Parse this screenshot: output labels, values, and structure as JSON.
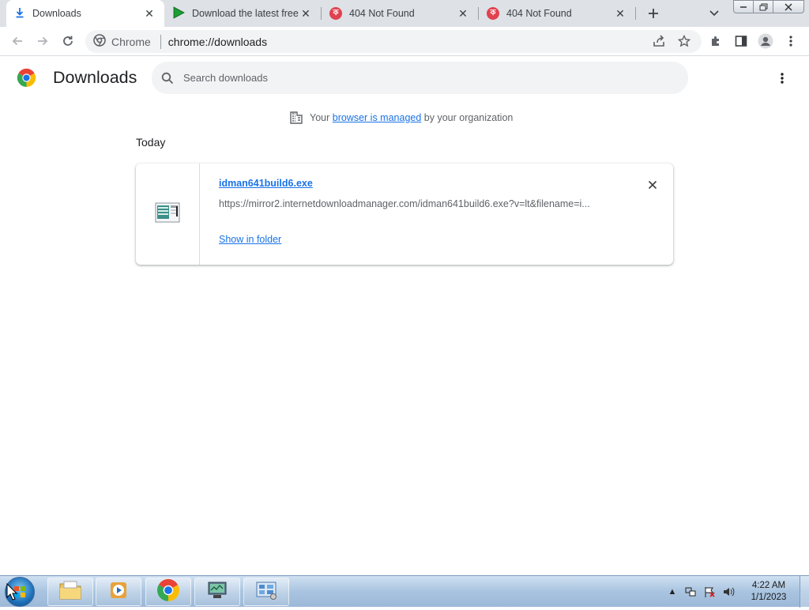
{
  "tabs": [
    {
      "title": "Downloads",
      "active": true
    },
    {
      "title": "Download the latest free"
    },
    {
      "title": "404 Not Found"
    },
    {
      "title": "404 Not Found"
    }
  ],
  "tab_icons": {
    "chars": "ক"
  },
  "toolbar": {
    "omnibox_chip": "Chrome",
    "url": "chrome://downloads"
  },
  "page": {
    "title": "Downloads",
    "search_placeholder": "Search downloads",
    "managed_prefix": "Your",
    "managed_link": "browser is managed",
    "managed_suffix": "by your organization",
    "date_header": "Today"
  },
  "download": {
    "file_name": "idman641build6.exe",
    "url": "https://mirror2.internetdownloadmanager.com/idman641build6.exe?v=lt&filename=i...",
    "action": "Show in folder"
  },
  "taskbar": {
    "time": "4:22 AM",
    "date": "1/1/2023"
  },
  "colors": {
    "accent": "#1a73e8",
    "tabstrip": "#dee1e6",
    "taskbar": "#a9c4e0"
  }
}
